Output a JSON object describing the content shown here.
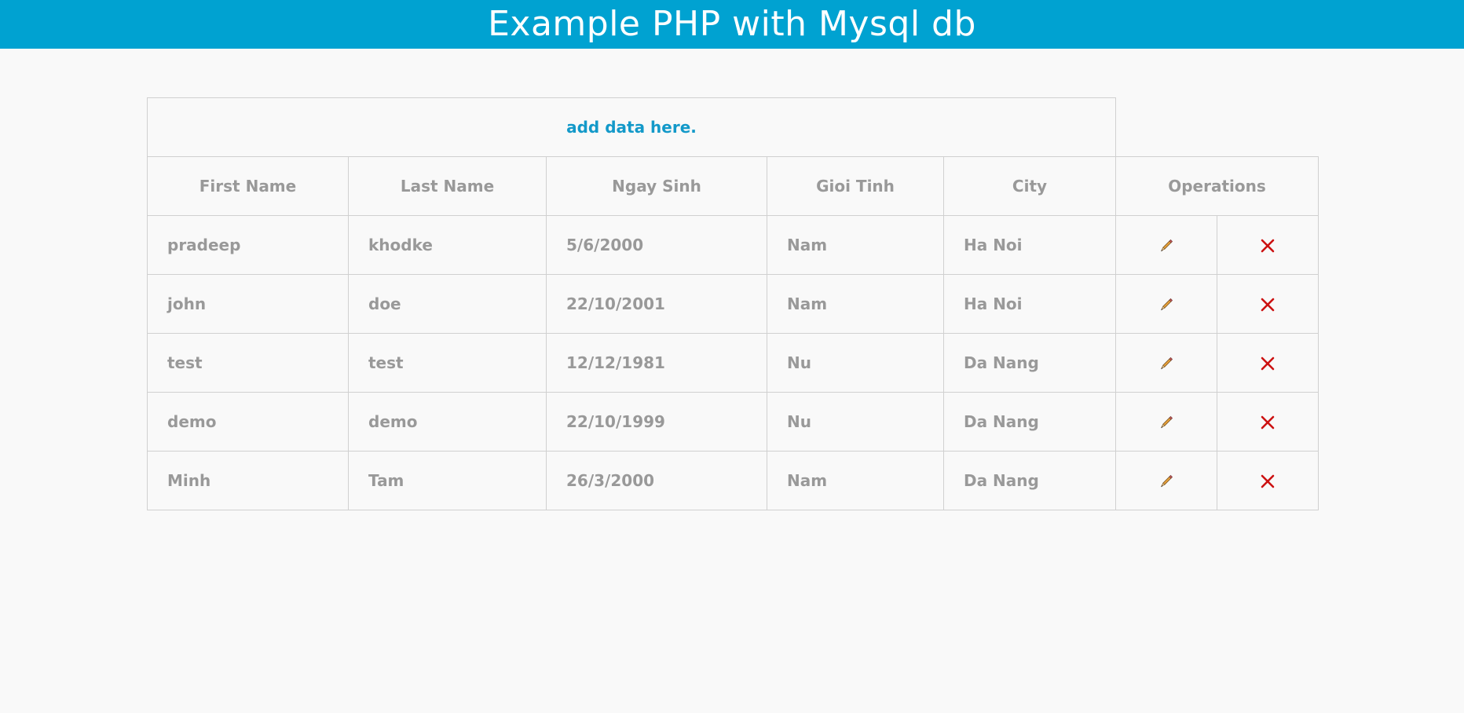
{
  "header": {
    "title": "Example PHP with Mysql db"
  },
  "add_link": {
    "label": "add data here."
  },
  "columns": [
    "First Name",
    "Last Name",
    "Ngay Sinh",
    "Gioi Tinh",
    "City",
    "Operations"
  ],
  "rows": [
    {
      "first": "pradeep",
      "last": "khodke",
      "birth": "5/6/2000",
      "gender": "Nam",
      "city": "Ha Noi"
    },
    {
      "first": "john",
      "last": "doe",
      "birth": "22/10/2001",
      "gender": "Nam",
      "city": "Ha Noi"
    },
    {
      "first": "test",
      "last": "test",
      "birth": "12/12/1981",
      "gender": "Nu",
      "city": "Da Nang"
    },
    {
      "first": "demo",
      "last": "demo",
      "birth": "22/10/1999",
      "gender": "Nu",
      "city": "Da Nang"
    },
    {
      "first": "Minh",
      "last": "Tam",
      "birth": "26/3/2000",
      "gender": "Nam",
      "city": "Da Nang"
    }
  ],
  "icons": {
    "edit": "pencil-icon",
    "delete": "delete-x-icon"
  },
  "colors": {
    "header_bg": "#00a2d1",
    "link": "#1399c9",
    "text": "#999999",
    "delete": "#cc1111"
  }
}
